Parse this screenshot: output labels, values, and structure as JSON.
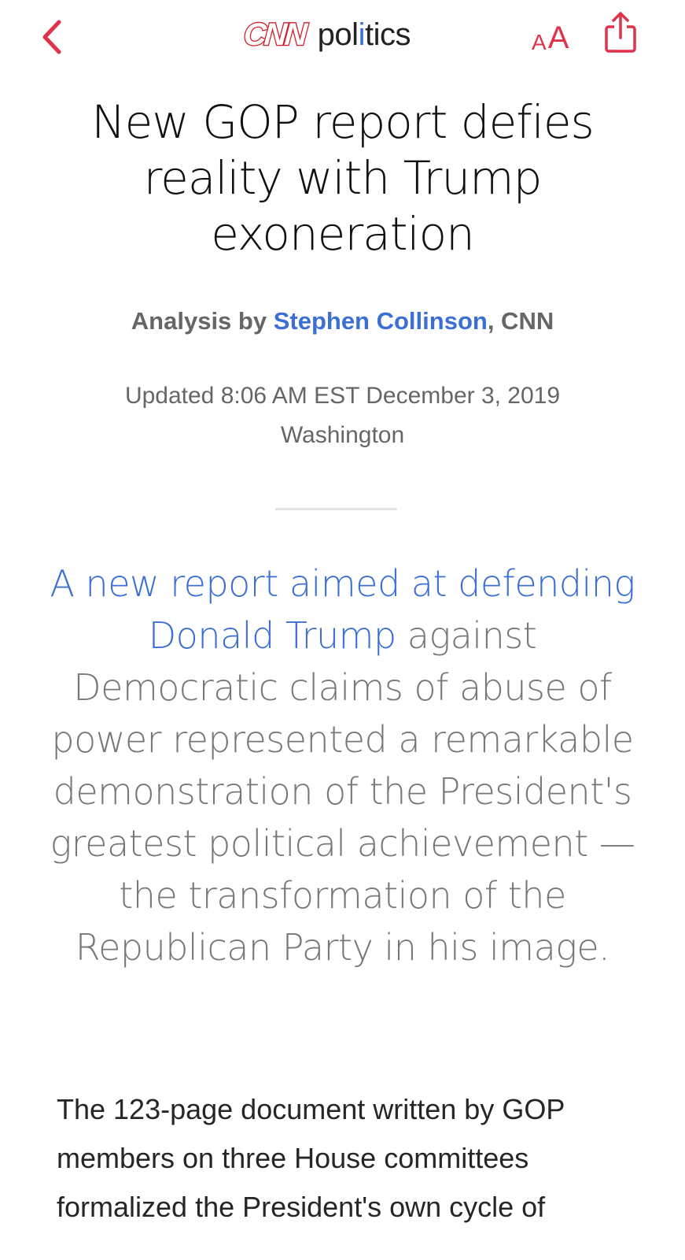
{
  "colors": {
    "accent_red": "#e0324b",
    "brand_red": "#d01f2e",
    "link_blue": "#3b6fd4",
    "gray_text": "#666666"
  },
  "toolbar": {
    "back_icon": "chevron-left-icon",
    "brand_logo": "CNN",
    "section_pre": "pol",
    "section_dot": "i",
    "section_post": "tics",
    "text_size_small": "A",
    "text_size_large": "A",
    "share_icon": "share-icon"
  },
  "article": {
    "headline": "New GOP report defies reality with Trump exoneration",
    "byline_prefix": "Analysis by ",
    "author": "Stephen Collinson",
    "byline_suffix": ", CNN",
    "updated": "Updated 8:06 AM EST December 3, 2019",
    "location": "Washington",
    "lede_link": "A new report aimed at defending Donald Trump",
    "lede_rest": " against Democratic claims of abuse of power represented a remarkable demonstration of the President's greatest political achievement — the transformation of the Republican Party in his image.",
    "body": "The 123-page document written by GOP members on three House committees formalized the President's own cycle of"
  }
}
